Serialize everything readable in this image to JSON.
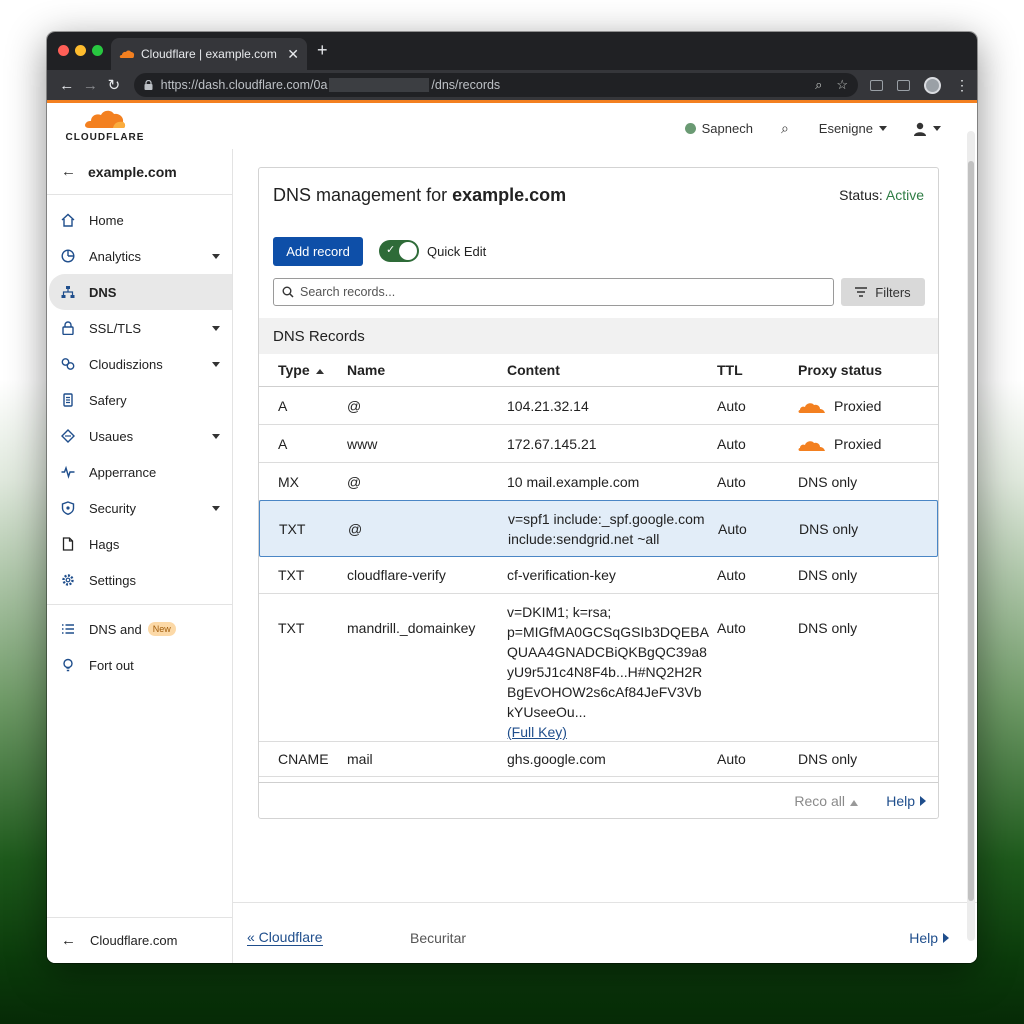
{
  "browser": {
    "tab_title": "Cloudflare | example.com | D",
    "url_prefix": "https://dash.cloudflare.com/0a",
    "url_suffix": "/dns/records",
    "new_tab": "+",
    "close": "✕"
  },
  "header": {
    "logo_text": "CLOUDFLARE",
    "status_link": "Sapnech",
    "account_menu": "Esenigne"
  },
  "sidebar": {
    "zone": "example.com",
    "items": [
      {
        "label": "Home",
        "icon": "home-icon"
      },
      {
        "label": "Analytics",
        "icon": "analytics-icon"
      },
      {
        "label": "DNS",
        "icon": "dns-network-icon"
      },
      {
        "label": "SSL/TLS",
        "icon": "lock-icon"
      },
      {
        "label": "Cloudiszions",
        "icon": "link-icon"
      },
      {
        "label": "Safery",
        "icon": "book-icon"
      },
      {
        "label": "Usaues",
        "icon": "diamond-icon"
      },
      {
        "label": "Apperrance",
        "icon": "pulse-icon"
      },
      {
        "label": "Security",
        "icon": "shield-icon"
      },
      {
        "label": "Hags",
        "icon": "page-icon"
      },
      {
        "label": "Settings",
        "icon": "gear-icon"
      }
    ],
    "extra_items": [
      {
        "label": "DNS and",
        "badge": "New",
        "icon": "list-icon"
      },
      {
        "label": "Fort out",
        "icon": "bulb-icon"
      }
    ],
    "bottom_link": "Cloudflare.com"
  },
  "main": {
    "title_prefix": "DNS management for ",
    "title_zone": "example.com",
    "status_label": "Status: ",
    "status_value": "Active",
    "add_record": "Add record",
    "quick_edit": "Quick Edit",
    "search_placeholder": "Search records...",
    "filters": "Filters",
    "records_heading": "DNS Records",
    "columns": {
      "type": "Type",
      "name": "Name",
      "content": "Content",
      "ttl": "TTL",
      "proxy": "Proxy status"
    },
    "records": [
      {
        "type": "A",
        "name": "@",
        "content": "104.21.32.14",
        "ttl": "Auto",
        "proxy": "Proxied"
      },
      {
        "type": "A",
        "name": "www",
        "content": "172.67.145.21",
        "ttl": "Auto",
        "proxy": "Proxied"
      },
      {
        "type": "MX",
        "name": "@",
        "content": "10 mail.example.com",
        "ttl": "Auto",
        "proxy": "DNS only"
      },
      {
        "type": "TXT",
        "name": "@",
        "content_line1": "v=spf1 include:_spf.google.com",
        "content_line2": "include:sendgrid.net ~all",
        "ttl": "Auto",
        "proxy": "DNS only"
      },
      {
        "type": "TXT",
        "name": "cloudflare-verify",
        "content": "cf-verification-key",
        "ttl": "Auto",
        "proxy": "DNS only"
      },
      {
        "type": "TXT",
        "name": "mandrill._domainkey",
        "content_lines": [
          "v=DKIM1; k=rsa;",
          "p=MIGfMA0GCSqGSIb3DQEBA",
          "QUAA4GNADCBiQKBgQC39a8",
          "yU9r5J1c4N8F4b...H#NQ2H2R",
          "BgEvOHOW2s6cAf84JeFV3Vb",
          "kYUseeOu..."
        ],
        "full_key": "(Full Key)",
        "ttl": "Auto",
        "proxy": "DNS only"
      },
      {
        "type": "CNAME",
        "name": "mail",
        "content": "ghs.google.com",
        "ttl": "Auto",
        "proxy": "DNS only"
      }
    ],
    "footer_reco": "Reco all",
    "footer_help": "Help"
  },
  "footer": {
    "cf_link": "« Cloudflare",
    "middle": "Becuritar",
    "help": "Help"
  },
  "colors": {
    "accent": "#f38020",
    "primary": "#0e4fa8",
    "active_status": "#2f7d45",
    "selected_row": "#e2edf8"
  }
}
